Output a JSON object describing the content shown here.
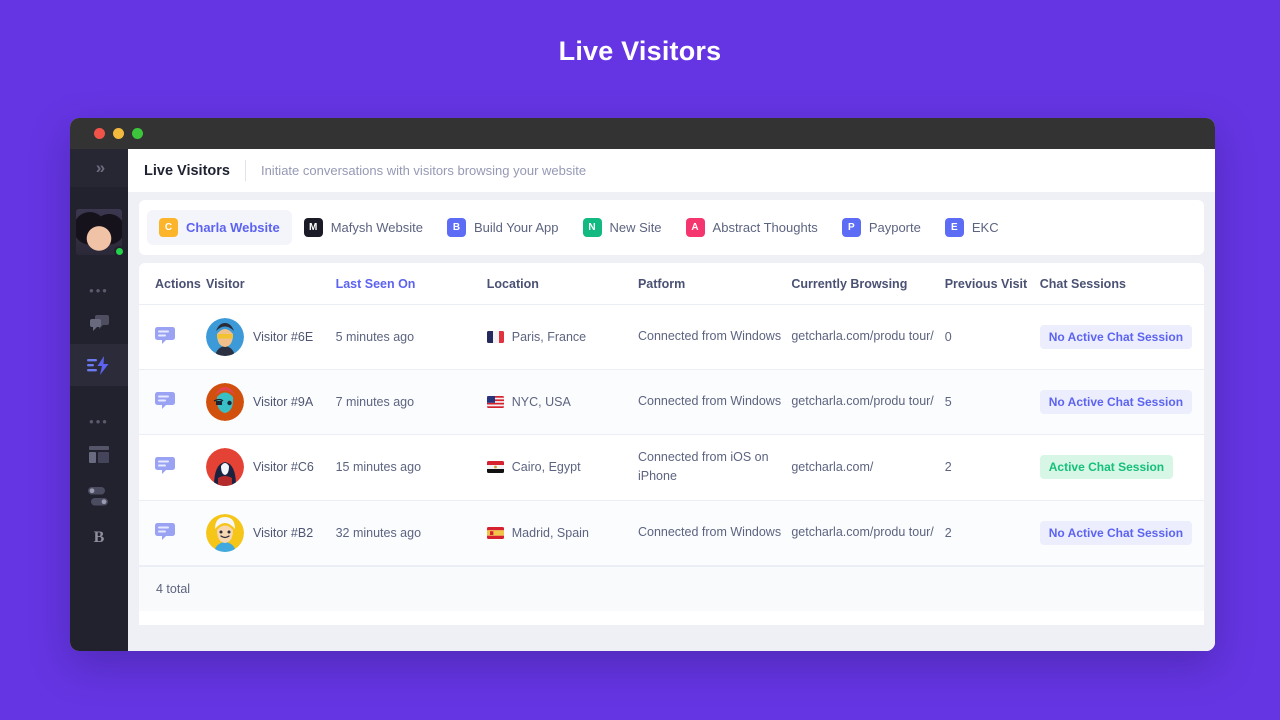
{
  "page": {
    "title": "Live Visitors",
    "background_color": "#6535e3"
  },
  "window": {
    "traffic_lights": [
      "close",
      "minimize",
      "maximize"
    ]
  },
  "sidebar": {
    "expand_icon": "chevrons-right-icon",
    "avatar": {
      "name": "user-avatar",
      "status": "online"
    },
    "items": [
      {
        "icon": "dots-separator"
      },
      {
        "icon": "chat-bubbles-icon",
        "active": false
      },
      {
        "icon": "live-lightning-icon",
        "active": true
      },
      {
        "icon": "dots-separator"
      },
      {
        "icon": "layout-panel-icon",
        "active": false
      },
      {
        "icon": "toggles-icon",
        "active": false
      },
      {
        "icon": "brand-b-icon",
        "label": "B",
        "active": false
      }
    ]
  },
  "topbar": {
    "title": "Live Visitors",
    "subtitle": "Initiate conversations with visitors browsing your website"
  },
  "site_tabs": [
    {
      "letter": "C",
      "label": "Charla Website",
      "color": "#fcb52b",
      "selected": true
    },
    {
      "letter": "M",
      "label": "Mafysh Website",
      "color": "#1b1b28",
      "selected": false
    },
    {
      "letter": "B",
      "label": "Build Your App",
      "color": "#5c6cf5",
      "selected": false
    },
    {
      "letter": "N",
      "label": "New Site",
      "color": "#12b981",
      "selected": false
    },
    {
      "letter": "A",
      "label": "Abstract Thoughts",
      "color": "#f4356e",
      "selected": false
    },
    {
      "letter": "P",
      "label": "Payporte",
      "color": "#5c6cf5",
      "selected": false
    },
    {
      "letter": "E",
      "label": "EKC",
      "color": "#5c6cf5",
      "selected": false
    }
  ],
  "table": {
    "columns": [
      {
        "key": "actions",
        "label": "Actions",
        "sorted": false
      },
      {
        "key": "visitor",
        "label": "Visitor",
        "sorted": false
      },
      {
        "key": "last",
        "label": "Last Seen On",
        "sorted": true
      },
      {
        "key": "location",
        "label": "Location",
        "sorted": false
      },
      {
        "key": "platform",
        "label": "Patform",
        "sorted": false
      },
      {
        "key": "browsing",
        "label": "Currently Browsing",
        "sorted": false
      },
      {
        "key": "previous",
        "label": "Previous Visit",
        "sorted": false
      },
      {
        "key": "chat",
        "label": "Chat Sessions",
        "sorted": false
      }
    ],
    "rows": [
      {
        "action_icon": "chat-bubble-icon",
        "visitor": "Visitor #6E",
        "avatar_color": "#3d9ad8",
        "avatar_kind": "man-sunglasses",
        "last_seen": "5 minutes ago",
        "location": "Paris, France",
        "flag": "fr",
        "platform": "Connected from Windows",
        "browsing": "getcharla.com/produ tour/",
        "previous_visit": "0",
        "chat_status": "No Active Chat Session",
        "chat_active": false
      },
      {
        "action_icon": "chat-bubble-icon",
        "visitor": "Visitor #9A",
        "avatar_color": "#d2500e",
        "avatar_kind": "alien-pirate",
        "last_seen": "7 minutes ago",
        "location": "NYC, USA",
        "flag": "us",
        "platform": "Connected from Windows",
        "browsing": "getcharla.com/produ tour/",
        "previous_visit": "5",
        "chat_status": "No Active Chat Session",
        "chat_active": false
      },
      {
        "action_icon": "chat-bubble-icon",
        "visitor": "Visitor #C6",
        "avatar_color": "#e34234",
        "avatar_kind": "hooded-figure",
        "last_seen": "15 minutes ago",
        "location": "Cairo, Egypt",
        "flag": "eg",
        "platform": "Connected from iOS on iPhone",
        "browsing": "getcharla.com/",
        "previous_visit": "2",
        "chat_status": "Active Chat Session",
        "chat_active": true
      },
      {
        "action_icon": "chat-bubble-icon",
        "visitor": "Visitor #B2",
        "avatar_color": "#f5c518",
        "avatar_kind": "cartoon-boy",
        "last_seen": "32 minutes ago",
        "location": "Madrid, Spain",
        "flag": "es",
        "platform": "Connected from Windows",
        "browsing": "getcharla.com/produ tour/",
        "previous_visit": "2",
        "chat_status": "No Active Chat Session",
        "chat_active": false
      }
    ],
    "footer": "4 total"
  },
  "colors": {
    "accent": "#5c63f0",
    "active_badge_text": "#14c07a",
    "background": "#6535e3"
  }
}
